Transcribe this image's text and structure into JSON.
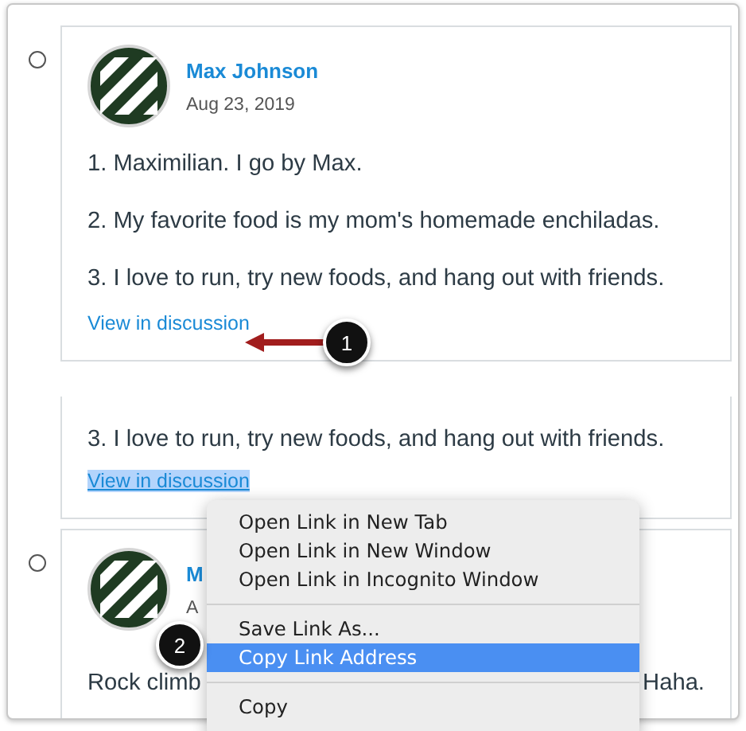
{
  "entries": [
    {
      "kind": "post",
      "selected": false,
      "author": "Max Johnson",
      "date": "Aug 23, 2019",
      "paragraphs": [
        "1. Maximilian. I go by Max.",
        "2. My favorite food is my mom's homemade enchiladas.",
        "3. I love to run, try new foods, and hang out with friends."
      ],
      "link": {
        "label": "View in discussion",
        "highlighted": false
      }
    },
    {
      "kind": "continuation",
      "paragraphs": [
        "3. I love to run, try new foods, and hang out with friends."
      ],
      "link": {
        "label": "View in discussion",
        "highlighted": true
      }
    },
    {
      "kind": "post",
      "selected": false,
      "author": "M",
      "date": "A",
      "fragments": [
        "Rock climb",
        "Haha."
      ]
    }
  ],
  "context_menu": {
    "groups": [
      [
        {
          "label": "Open Link in New Tab",
          "selected": false
        },
        {
          "label": "Open Link in New Window",
          "selected": false
        },
        {
          "label": "Open Link in Incognito Window",
          "selected": false
        }
      ],
      [
        {
          "label": "Save Link As...",
          "selected": false
        },
        {
          "label": "Copy Link Address",
          "selected": true
        }
      ],
      [
        {
          "label": "Copy",
          "selected": false
        }
      ]
    ]
  },
  "callouts": [
    {
      "number": "1",
      "kind": "arrow"
    },
    {
      "number": "2",
      "kind": "badge"
    }
  ]
}
